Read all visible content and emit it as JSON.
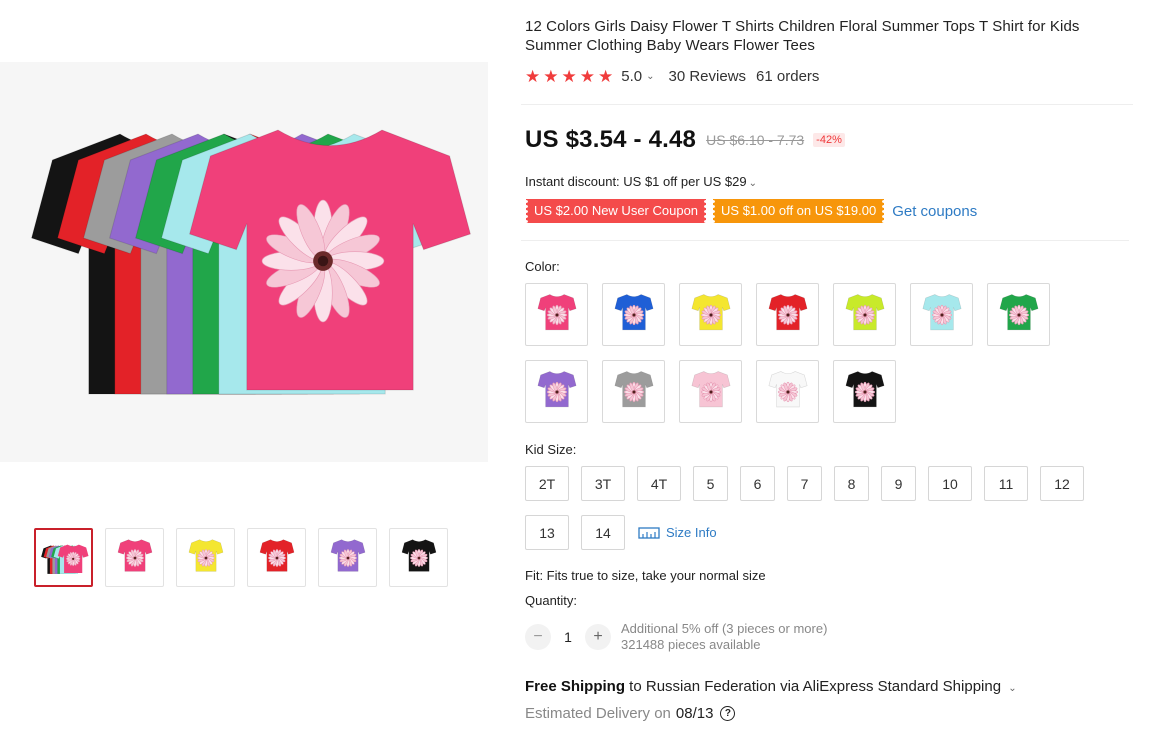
{
  "product": {
    "title": "12 Colors Girls Daisy Flower T Shirts Children Floral Summer Tops T Shirt for Kids Summer Clothing Baby Wears Flower Tees",
    "rating": {
      "stars": 5,
      "value": "5.0",
      "reviews": "30 Reviews",
      "orders": "61 orders"
    },
    "price": {
      "current": "US $3.54 - 4.48",
      "original": "US $6.10 - 7.73",
      "discount": "-42%"
    },
    "instant_discount": "Instant discount: US $1 off per US $29",
    "coupons": [
      {
        "label": "US $2.00 New User Coupon",
        "color": "#f44b4b"
      },
      {
        "label": "US $1.00 off on US $19.00",
        "color": "#f7960b"
      }
    ],
    "get_coupons": "Get coupons",
    "color_label": "Color:",
    "colors": [
      {
        "name": "rose",
        "hex": "#f0407a"
      },
      {
        "name": "blue",
        "hex": "#1f5fd6"
      },
      {
        "name": "yellow",
        "hex": "#f4e630"
      },
      {
        "name": "red",
        "hex": "#e32228"
      },
      {
        "name": "lime",
        "hex": "#c8ea2a"
      },
      {
        "name": "light-blue",
        "hex": "#a6e8ec"
      },
      {
        "name": "green",
        "hex": "#21a64a"
      },
      {
        "name": "purple",
        "hex": "#9269cf"
      },
      {
        "name": "gray",
        "hex": "#9c9c9c"
      },
      {
        "name": "pink",
        "hex": "#f7c4d4"
      },
      {
        "name": "white",
        "hex": "#f8f8f8"
      },
      {
        "name": "black",
        "hex": "#141414"
      }
    ],
    "size_label": "Kid Size:",
    "sizes": [
      "2T",
      "3T",
      "4T",
      "5",
      "6",
      "7",
      "8",
      "9",
      "10",
      "11",
      "12",
      "13",
      "14"
    ],
    "size_info": "Size Info",
    "fit": "Fit: Fits true to size, take your normal size",
    "quantity_label": "Quantity:",
    "quantity": "1",
    "qty_note_1": "Additional 5% off (3 pieces or more)",
    "qty_note_2": "321488 pieces available",
    "shipping_free": "Free Shipping",
    "shipping_rest": " to Russian Federation via AliExpress Standard Shipping",
    "delivery_label": "Estimated Delivery on",
    "delivery_date": "08/13"
  },
  "gallery": {
    "main_shirts": [
      "#141414",
      "#e32228",
      "#9c9c9c",
      "#9269cf",
      "#21a64a",
      "#a6e8ec",
      "#f0407a"
    ],
    "thumbnails": [
      {
        "name": "multi",
        "hex": "#f0407a"
      },
      {
        "name": "rose",
        "hex": "#f0407a"
      },
      {
        "name": "yellow",
        "hex": "#f4e630"
      },
      {
        "name": "red",
        "hex": "#e32228"
      },
      {
        "name": "purple",
        "hex": "#9269cf"
      },
      {
        "name": "black",
        "hex": "#141414"
      }
    ]
  },
  "icons": {
    "star": "★",
    "caret": "⌄",
    "minus": "−",
    "plus": "+",
    "help": "?"
  }
}
